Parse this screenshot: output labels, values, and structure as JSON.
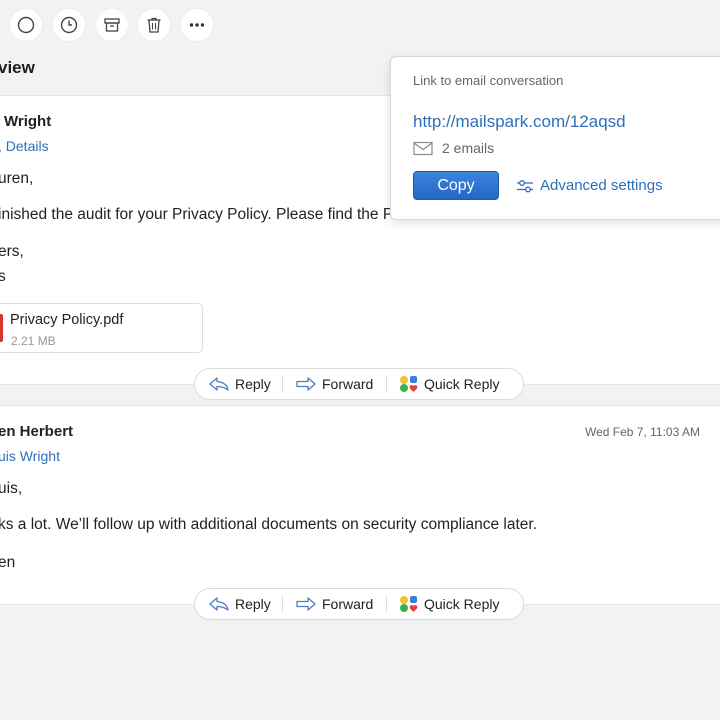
{
  "toolbar": {
    "icons": [
      "circle-icon",
      "clock-icon",
      "archive-icon",
      "trash-icon",
      "more-icon"
    ]
  },
  "thread": {
    "title": "view"
  },
  "messages": [
    {
      "sender": "Wright",
      "recipients": ", Details",
      "lines": [
        "uren,",
        "inished the audit for your Privacy Policy. Please find the PDF attached.",
        "ers,",
        "s"
      ],
      "attachment": {
        "name": "Privacy Policy.pdf",
        "size": "2.21 MB"
      }
    },
    {
      "sender": "en Herbert",
      "recipients": "uis Wright",
      "date": "Wed Feb 7, 11:03 AM",
      "lines": [
        "uis,",
        "ks a lot. We’ll follow up with additional documents on security compliance later.",
        "en"
      ]
    }
  ],
  "actions": {
    "reply": "Reply",
    "forward": "Forward",
    "quick_reply": "Quick Reply"
  },
  "share_popup": {
    "title": "Link to email conversation",
    "link": "http://mailspark.com/12aqsd",
    "email_count": "2 emails",
    "copy_label": "Copy",
    "advanced_label": "Advanced settings"
  },
  "colors": {
    "accent": "#2d6fbd",
    "copy_button": "#2a6fcf",
    "pdf_icon": "#d9362b",
    "background": "#f2f2f3"
  }
}
